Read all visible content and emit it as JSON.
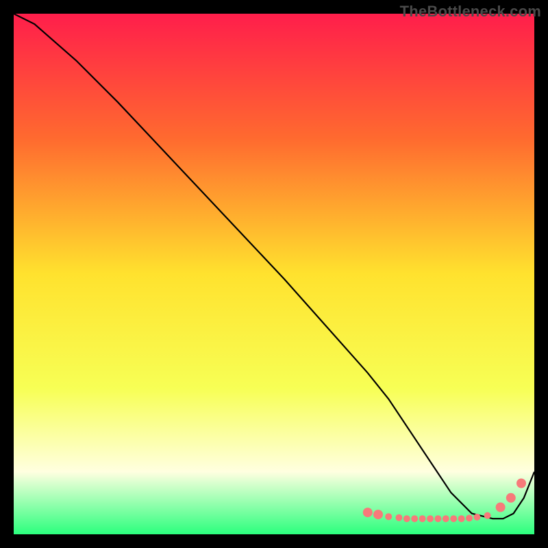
{
  "watermark": "TheBottleneck.com",
  "chart_data": {
    "type": "line",
    "title": "",
    "xlabel": "",
    "ylabel": "",
    "xlim": [
      0,
      100
    ],
    "ylim": [
      0,
      100
    ],
    "background_gradient": {
      "top": "#ff1e4b",
      "mid_upper": "#ff8a2a",
      "mid": "#ffe22e",
      "mid_lower": "#f7ff6a",
      "pale": "#ffffd0",
      "bottom": "#2bff7d"
    },
    "series": [
      {
        "name": "bottleneck-curve",
        "color": "#000000",
        "x": [
          0,
          4,
          12,
          20,
          28,
          36,
          44,
          52,
          60,
          68,
          72,
          76,
          80,
          84,
          88,
          92,
          94,
          96,
          98,
          100
        ],
        "y": [
          100,
          98,
          91,
          83,
          74.5,
          66,
          57.5,
          49,
          40,
          31,
          26,
          20,
          14,
          8,
          4,
          3,
          3,
          4,
          7,
          12
        ]
      }
    ],
    "markers": {
      "name": "highlight-dots",
      "color": "#f77a7a",
      "radius_small": 5,
      "radius_large": 7,
      "points": [
        {
          "x": 68,
          "y": 4.2,
          "r": "large"
        },
        {
          "x": 70,
          "y": 3.8,
          "r": "large"
        },
        {
          "x": 72,
          "y": 3.4,
          "r": "small"
        },
        {
          "x": 74,
          "y": 3.2,
          "r": "small"
        },
        {
          "x": 75.5,
          "y": 3.0,
          "r": "small"
        },
        {
          "x": 77,
          "y": 3.0,
          "r": "small"
        },
        {
          "x": 78.5,
          "y": 3.0,
          "r": "small"
        },
        {
          "x": 80,
          "y": 3.0,
          "r": "small"
        },
        {
          "x": 81.5,
          "y": 3.0,
          "r": "small"
        },
        {
          "x": 83,
          "y": 3.0,
          "r": "small"
        },
        {
          "x": 84.5,
          "y": 3.0,
          "r": "small"
        },
        {
          "x": 86,
          "y": 3.0,
          "r": "small"
        },
        {
          "x": 87.5,
          "y": 3.1,
          "r": "small"
        },
        {
          "x": 89,
          "y": 3.3,
          "r": "small"
        },
        {
          "x": 91,
          "y": 3.6,
          "r": "small"
        },
        {
          "x": 93.5,
          "y": 5.2,
          "r": "large"
        },
        {
          "x": 95.5,
          "y": 7.0,
          "r": "large"
        },
        {
          "x": 97.5,
          "y": 9.8,
          "r": "large"
        }
      ]
    }
  }
}
